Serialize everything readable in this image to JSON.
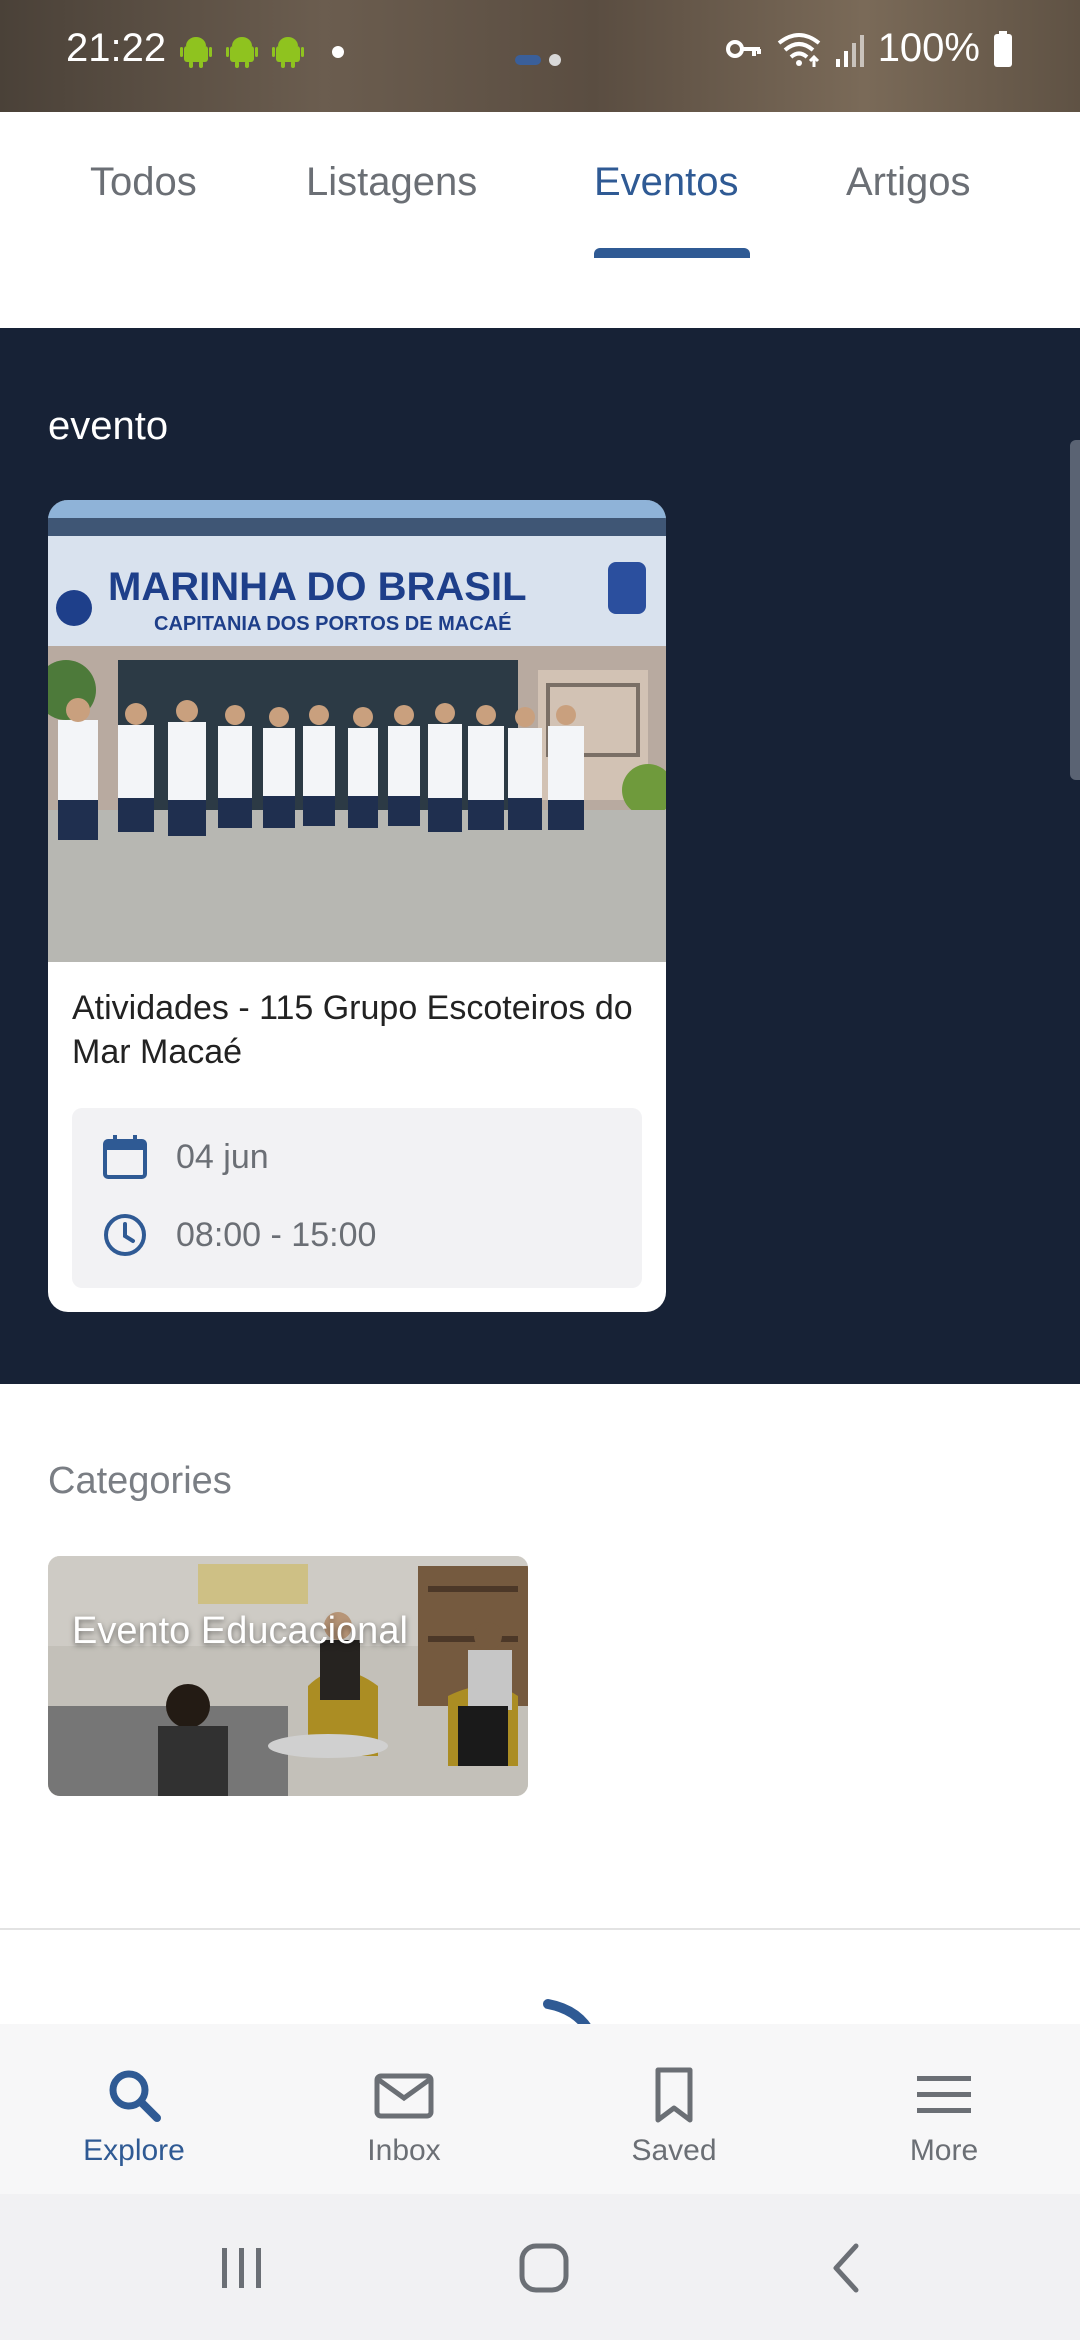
{
  "status_bar": {
    "time": "21:22",
    "battery": "100%",
    "icons": [
      "android-icon",
      "android-icon",
      "android-icon",
      "vpn-key-icon",
      "wifi-icon",
      "signal-icon",
      "battery-icon"
    ]
  },
  "tabs": [
    {
      "label": "Todos",
      "active": false
    },
    {
      "label": "Listagens",
      "active": false
    },
    {
      "label": "Eventos",
      "active": true
    },
    {
      "label": "Artigos",
      "active": false
    }
  ],
  "events_section": {
    "title": "evento",
    "events": [
      {
        "title": "Atividades - 115 Grupo Escoteiros do Mar Macaé",
        "date": "04 jun",
        "time": "08:00 - 15:00",
        "photo_sign_line1": "MARINHA DO BRASIL",
        "photo_sign_line2": "CAPITANIA DOS PORTOS DE MACAÉ"
      }
    ]
  },
  "categories": {
    "title": "Categories",
    "items": [
      {
        "label": "Evento Educacional"
      }
    ]
  },
  "bottom_nav": [
    {
      "label": "Explore",
      "icon": "search-icon",
      "active": true
    },
    {
      "label": "Inbox",
      "icon": "mail-icon",
      "active": false
    },
    {
      "label": "Saved",
      "icon": "bookmark-icon",
      "active": false
    },
    {
      "label": "More",
      "icon": "menu-icon",
      "active": false
    }
  ],
  "colors": {
    "accent": "#2f5a94",
    "dark_section_bg": "#172236",
    "muted_text": "#6b6f75"
  }
}
